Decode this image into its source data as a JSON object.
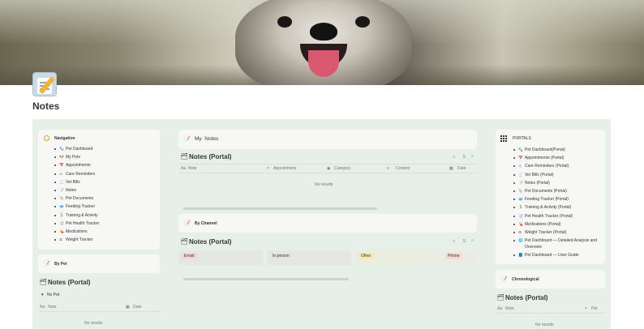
{
  "page": {
    "title": "Notes",
    "icon": "memo-pencil-icon"
  },
  "navigation": {
    "title": "Navigation",
    "items": [
      {
        "icon": "paw",
        "label": "Pet Dashboard"
      },
      {
        "icon": "dog",
        "label": "My Pets"
      },
      {
        "icon": "calendar",
        "label": "Appointments"
      },
      {
        "icon": "warning",
        "label": "Care Reminders"
      },
      {
        "icon": "receipt",
        "label": "Vet Bills"
      },
      {
        "icon": "note",
        "label": "Notes"
      },
      {
        "icon": "paperclip",
        "label": "Pet Documents"
      },
      {
        "icon": "bowl",
        "label": "Feeding Tracker"
      },
      {
        "icon": "running",
        "label": "Training & Activity"
      },
      {
        "icon": "stethoscope",
        "label": "Pet Health Tracker"
      },
      {
        "icon": "pill",
        "label": "Medications"
      },
      {
        "icon": "scale",
        "label": "Weight Tracker"
      }
    ]
  },
  "by_pet": {
    "header": "By Pet",
    "db_title": "Notes (Portal)",
    "group": "No Pet",
    "columns": [
      "Note",
      "Date"
    ],
    "empty": "No results"
  },
  "my_notes": {
    "header": "My  Notes",
    "db_title": "Notes (Portal)",
    "columns": [
      "Note",
      "Appointment",
      "Category",
      "Content",
      "Date"
    ],
    "empty": "No results"
  },
  "by_channel": {
    "header": "By Channel",
    "db_title": "Notes (Portal)",
    "groups": [
      {
        "label": "Email",
        "color": "#f3d7e0",
        "bg": "#e4e7e3"
      },
      {
        "label": "In person",
        "color": "#e3e3e1",
        "bg": "#e4e7e3"
      },
      {
        "label": "Other",
        "color": "#f4e8b8",
        "bg": "#eaeee0"
      },
      {
        "label": "Phone",
        "color": "#f6d9d2",
        "bg": "#eceae4"
      }
    ]
  },
  "portals": {
    "title": "PORTALS",
    "items": [
      {
        "icon": "paw",
        "label": "Pet Dashboard(Portal)"
      },
      {
        "icon": "calendar",
        "label": "Appointments (Portal)"
      },
      {
        "icon": "warning",
        "label": "Care Reminders (Portal)"
      },
      {
        "icon": "receipt",
        "label": "Vet Bills (Portal)"
      },
      {
        "icon": "note",
        "label": "Notes (Portal)"
      },
      {
        "icon": "paperclip",
        "label": "Pet Documents (Portal)"
      },
      {
        "icon": "bowl",
        "label": "Feeding Tracker (Portal)"
      },
      {
        "icon": "running",
        "label": "Training & Activity (Portal)"
      },
      {
        "icon": "stethoscope",
        "label": "Pet Health Tracker (Portal)"
      },
      {
        "icon": "pill",
        "label": "Medications (Portal)"
      },
      {
        "icon": "scale",
        "label": "Weight Tracker (Portal)"
      },
      {
        "icon": "globe",
        "label": "Pet Dashboard — Detailed Analysis and Overview"
      },
      {
        "icon": "book",
        "label": "Pet Dashboard — User Guide"
      }
    ]
  },
  "chronological": {
    "header": "Chronological",
    "db_title": "Notes (Portal)",
    "columns": [
      "Note",
      "Pet"
    ],
    "empty": "No results"
  }
}
